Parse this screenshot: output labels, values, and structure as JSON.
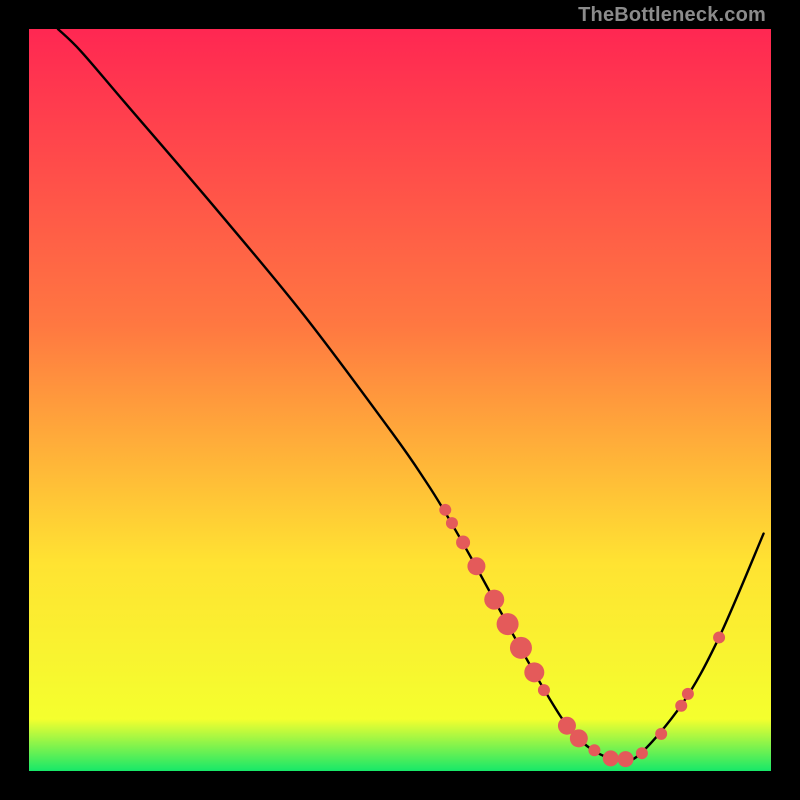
{
  "watermark": "TheBottleneck.com",
  "chart_data": {
    "type": "line",
    "title": "",
    "xlabel": "",
    "ylabel": "",
    "xlim": [
      0,
      100
    ],
    "ylim": [
      0,
      100
    ],
    "grid": false,
    "legend": false,
    "background_gradient": {
      "top": "#ff2752",
      "mid_upper": "#ff7841",
      "mid": "#ffe332",
      "mid_lower": "#f4ff2e",
      "bottom": "#17e869"
    },
    "series": [
      {
        "name": "bottleneck-curve",
        "color": "#000000",
        "x": [
          3.9,
          7,
          13,
          25,
          37,
          49,
          53.5,
          56,
          60,
          66,
          70,
          73,
          76,
          79,
          82,
          88,
          93,
          99
        ],
        "y": [
          100,
          97,
          90,
          76,
          61.5,
          45.5,
          39,
          35,
          28,
          17,
          10,
          5.5,
          2.8,
          1.6,
          2,
          9,
          18,
          32
        ]
      }
    ],
    "scatter": {
      "name": "markers",
      "color": "#e45a5a",
      "points": [
        {
          "x": 56.1,
          "y": 35.2
        },
        {
          "x": 57.0,
          "y": 33.4
        },
        {
          "x": 58.5,
          "y": 30.8,
          "r": 7
        },
        {
          "x": 60.3,
          "y": 27.6,
          "r": 9
        },
        {
          "x": 62.7,
          "y": 23.1,
          "r": 10
        },
        {
          "x": 64.5,
          "y": 19.8,
          "r": 11
        },
        {
          "x": 66.3,
          "y": 16.6,
          "r": 11
        },
        {
          "x": 68.1,
          "y": 13.3,
          "r": 10
        },
        {
          "x": 69.4,
          "y": 10.9
        },
        {
          "x": 72.5,
          "y": 6.1,
          "r": 9
        },
        {
          "x": 74.1,
          "y": 4.4,
          "r": 9
        },
        {
          "x": 76.2,
          "y": 2.8
        },
        {
          "x": 78.4,
          "y": 1.7,
          "r": 8
        },
        {
          "x": 80.4,
          "y": 1.6,
          "r": 8
        },
        {
          "x": 82.6,
          "y": 2.4
        },
        {
          "x": 85.2,
          "y": 5.0
        },
        {
          "x": 87.9,
          "y": 8.8
        },
        {
          "x": 88.8,
          "y": 10.4
        },
        {
          "x": 93.0,
          "y": 18.0
        }
      ],
      "default_r": 6
    }
  }
}
